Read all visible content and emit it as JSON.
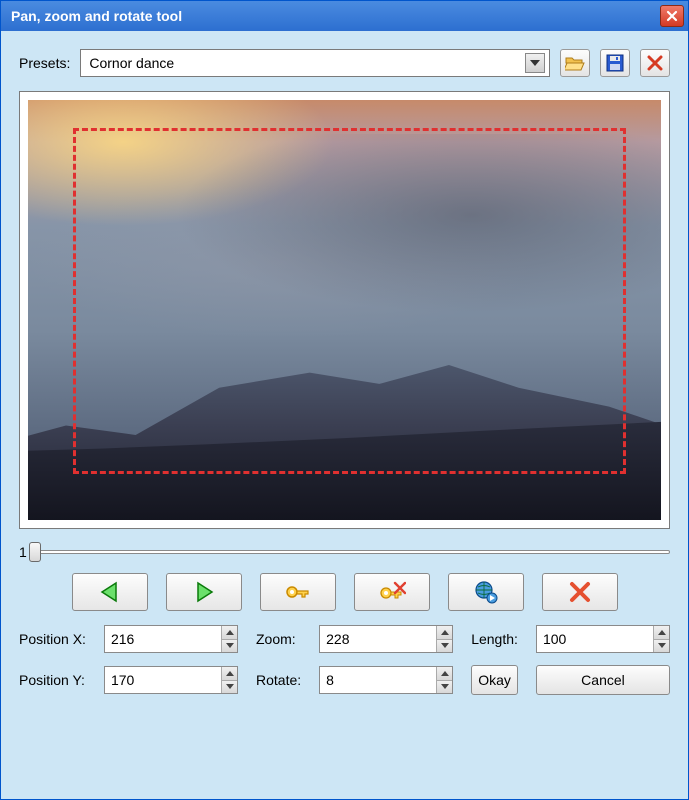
{
  "window": {
    "title": "Pan, zoom and rotate tool"
  },
  "presets": {
    "label": "Presets:",
    "selected": "Cornor dance"
  },
  "slider": {
    "value_label": "1"
  },
  "params": {
    "position_x": {
      "label": "Position X:",
      "value": "216"
    },
    "position_y": {
      "label": "Position Y:",
      "value": "170"
    },
    "zoom": {
      "label": "Zoom:",
      "value": "228"
    },
    "rotate": {
      "label": "Rotate:",
      "value": "8"
    },
    "length": {
      "label": "Length:",
      "value": "100"
    }
  },
  "buttons": {
    "okay": "Okay",
    "cancel": "Cancel"
  }
}
